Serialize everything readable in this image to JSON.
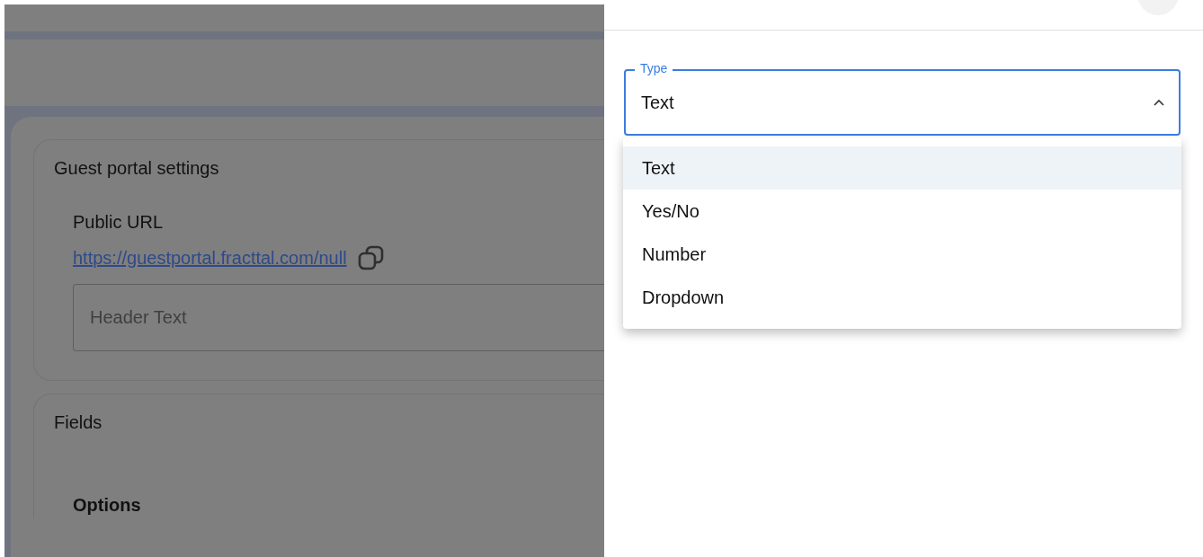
{
  "guest_portal": {
    "title": "Guest portal settings",
    "public_url_label": "Public URL",
    "public_url": "https://guestportal.fracttal.com/null",
    "header_text": {
      "placeholder": "Header Text"
    }
  },
  "fields": {
    "title": "Fields",
    "options_heading": "Options"
  },
  "type_select": {
    "label": "Type",
    "value": "Text",
    "expanded": true,
    "options": [
      {
        "label": "Text",
        "selected": true
      },
      {
        "label": "Yes/No",
        "selected": false
      },
      {
        "label": "Number",
        "selected": false
      },
      {
        "label": "Dropdown",
        "selected": false
      }
    ]
  }
}
